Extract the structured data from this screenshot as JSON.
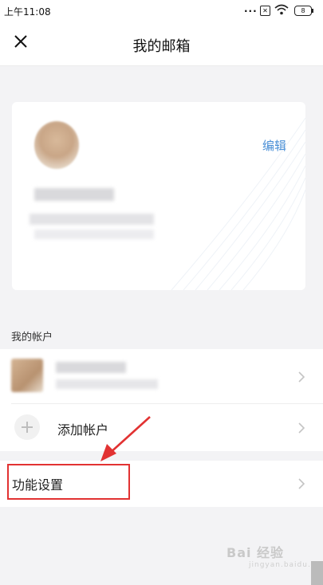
{
  "status_bar": {
    "time": "上午11:08",
    "dots": "...",
    "sim_icon": "sim-off-icon",
    "wifi_icon": "wifi-icon",
    "battery_level": "8"
  },
  "navbar": {
    "title": "我的邮箱",
    "close_icon": "close-icon"
  },
  "profile_card": {
    "edit_label": "编辑"
  },
  "accounts_section": {
    "label": "我的帐户",
    "add_account_label": "添加帐户"
  },
  "settings_section": {
    "feature_settings_label": "功能设置"
  },
  "annotations": {
    "highlight_color": "#e23232"
  },
  "watermark": {
    "text": "Bai 经验",
    "sub": "jingyan.baidu.com"
  }
}
